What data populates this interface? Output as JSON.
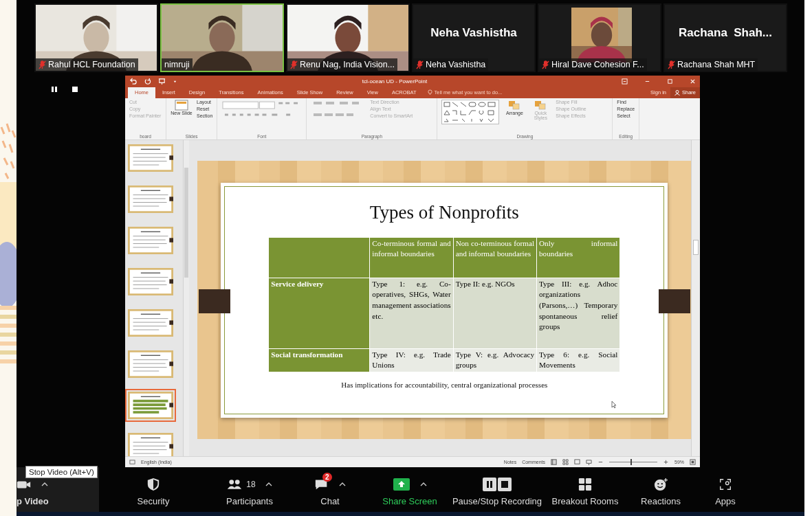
{
  "participants": [
    {
      "name": "Rahul HCL Foundation",
      "kind": "video",
      "muted": true,
      "speaking": false
    },
    {
      "name": "nimruji",
      "kind": "video",
      "muted": false,
      "speaking": true
    },
    {
      "name": "Renu Nag, India Vision...",
      "kind": "video",
      "muted": true,
      "speaking": false
    },
    {
      "name": "Neha Vashistha",
      "kind": "name",
      "display_name": "Neha Vashistha",
      "muted": true,
      "speaking": false
    },
    {
      "name": "Hiral Dave Cohesion F...",
      "kind": "portrait",
      "muted": true,
      "speaking": false
    },
    {
      "name": "Rachana Shah MHT",
      "kind": "name",
      "display_name": "Rachana  Shah...",
      "muted": true,
      "speaking": false
    }
  ],
  "powerpoint": {
    "title": "tcl-ocean UD - PowerPoint",
    "tabs": [
      {
        "label": "Home",
        "selected": true
      },
      {
        "label": "Insert",
        "selected": false
      },
      {
        "label": "Design",
        "selected": false
      },
      {
        "label": "Transitions",
        "selected": false
      },
      {
        "label": "Animations",
        "selected": false
      },
      {
        "label": "Slide Show",
        "selected": false
      },
      {
        "label": "Review",
        "selected": false
      },
      {
        "label": "View",
        "selected": false
      },
      {
        "label": "ACROBAT",
        "selected": false
      }
    ],
    "tell_me": "Tell me what you want to do...",
    "sign_in": "Sign in",
    "share": "Share",
    "ribbon_groups": [
      {
        "label": "board",
        "kind": "list",
        "items": [
          {
            "label": "Cut",
            "disabled": true
          },
          {
            "label": "Copy",
            "disabled": true
          },
          {
            "label": "Format Painter",
            "disabled": true
          }
        ]
      },
      {
        "label": "Slides",
        "kind": "slides",
        "big": "New Slide",
        "items": [
          {
            "label": "Layout",
            "disabled": false
          },
          {
            "label": "Reset",
            "disabled": false
          },
          {
            "label": "Section",
            "disabled": false
          }
        ]
      },
      {
        "label": "Font",
        "kind": "font"
      },
      {
        "label": "Paragraph",
        "kind": "paragraph",
        "items": [
          {
            "label": "Text Direction",
            "disabled": true
          },
          {
            "label": "Align Text",
            "disabled": true
          },
          {
            "label": "Convert to SmartArt",
            "disabled": true
          }
        ]
      },
      {
        "label": "Drawing",
        "kind": "drawing",
        "big": [
          {
            "label": "Arrange",
            "disabled": false
          },
          {
            "label": "Quick Styles",
            "disabled": true
          }
        ],
        "items": [
          {
            "label": "Shape Fill",
            "disabled": true
          },
          {
            "label": "Shape Outline",
            "disabled": true
          },
          {
            "label": "Shape Effects",
            "disabled": true
          }
        ]
      },
      {
        "label": "Editing",
        "kind": "list",
        "items": [
          {
            "label": "Find",
            "disabled": false
          },
          {
            "label": "Replace",
            "disabled": false
          },
          {
            "label": "Select",
            "disabled": false
          }
        ]
      }
    ],
    "thumbnails": [
      {
        "selected": false
      },
      {
        "selected": false
      },
      {
        "selected": false
      },
      {
        "selected": false
      },
      {
        "selected": false
      },
      {
        "selected": false
      },
      {
        "selected": true
      },
      {
        "selected": false
      }
    ],
    "slide": {
      "title": "Types of Nonprofits",
      "column_headers": [
        "Co-terminous formal and informal boundaries",
        "Non co-terminous formal and informal boundaries",
        "Only informal boundaries"
      ],
      "rows": [
        {
          "label": "Service delivery",
          "cells": [
            "Type 1: e.g. Co-operatives, SHGs, Water management associations etc.",
            "Type II: e.g. NGOs",
            "Type III: e.g. Adhoc organizations (Parsons,…) Temporary spontaneous relief groups"
          ]
        },
        {
          "label": "Social transformation",
          "cells": [
            "Type IV: e.g. Trade Unions",
            "Type V: e.g. Advocacy groups",
            "Type 6: e.g. Social Movements"
          ]
        }
      ],
      "note": "Has implications for accountability, central organizational processes"
    },
    "status_bar": {
      "language": "English (India)",
      "notes": "Notes",
      "comments": "Comments",
      "zoom": "59%",
      "level": 0.45
    }
  },
  "toolbar": {
    "tooltip": "Stop Video (Alt+V)",
    "buttons": [
      {
        "kind": "video",
        "label": "p Video",
        "caret": true
      },
      {
        "kind": "security",
        "label": "Security",
        "caret": false
      },
      {
        "kind": "participants",
        "label": "Participants",
        "count": "18",
        "caret": true
      },
      {
        "kind": "chat",
        "label": "Chat",
        "badge": "2",
        "caret": true
      },
      {
        "kind": "share",
        "label": "Share Screen",
        "caret": true
      },
      {
        "kind": "record",
        "label": "Pause/Stop Recording",
        "caret": false
      },
      {
        "kind": "breakout",
        "label": "Breakout Rooms",
        "caret": false
      },
      {
        "kind": "reactions",
        "label": "Reactions",
        "caret": false
      },
      {
        "kind": "apps",
        "label": "Apps",
        "caret": false
      }
    ]
  }
}
